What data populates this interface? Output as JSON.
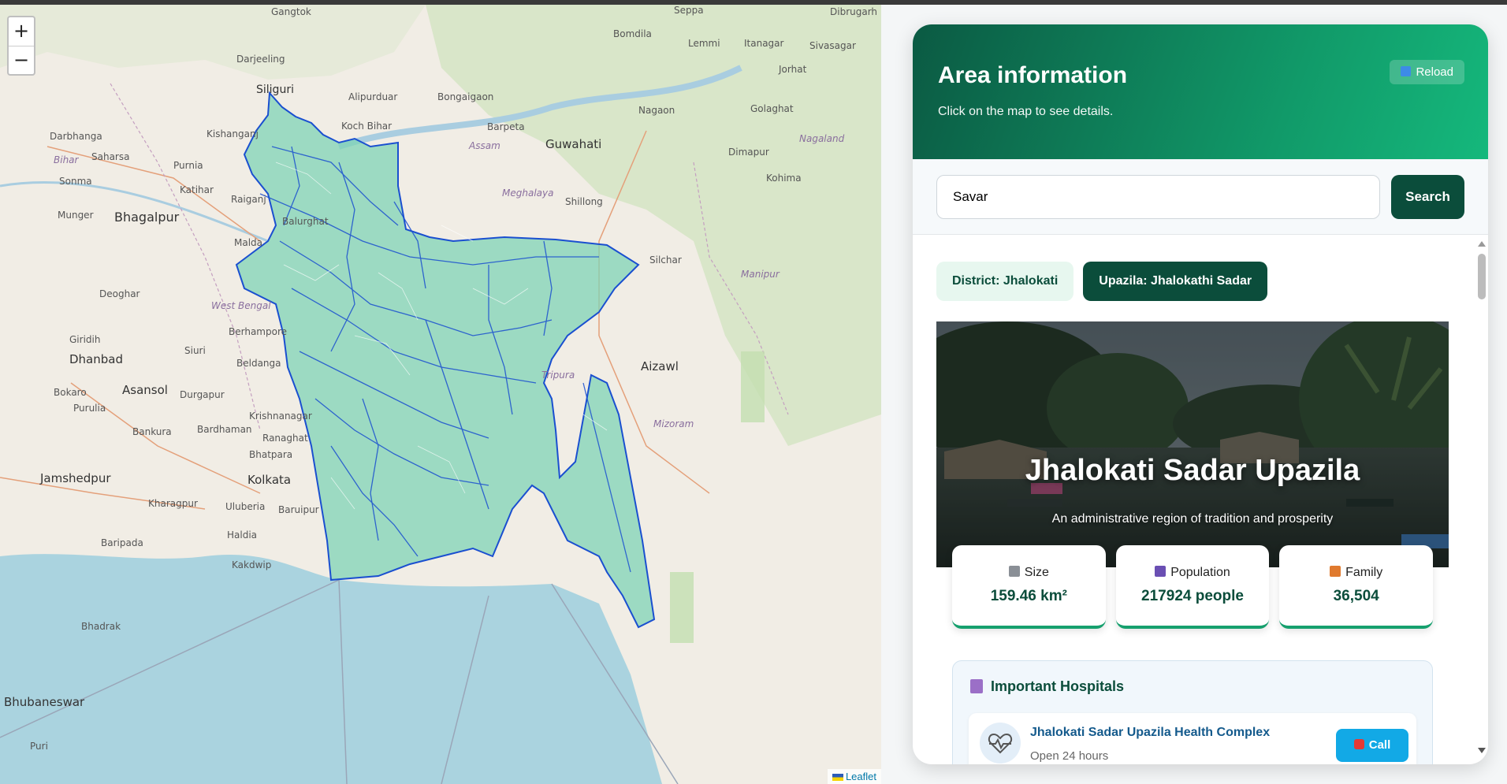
{
  "map": {
    "zoom_in": "+",
    "zoom_out": "−",
    "attribution": "Leaflet",
    "labels": [
      {
        "text": "Gangtok"
      },
      {
        "text": "Seppa"
      },
      {
        "text": "Dibrugarh"
      },
      {
        "text": "Bomdila"
      },
      {
        "text": "Lemmi"
      },
      {
        "text": "Itanagar"
      },
      {
        "text": "Sivasagar"
      },
      {
        "text": "Darjeeling"
      },
      {
        "text": "Jorhat"
      },
      {
        "text": "Siliguri"
      },
      {
        "text": "Alipurduar"
      },
      {
        "text": "Bongaigaon"
      },
      {
        "text": "Nagaon"
      },
      {
        "text": "Golaghat"
      },
      {
        "text": "Kishanganj"
      },
      {
        "text": "Koch Bihar"
      },
      {
        "text": "Barpeta"
      },
      {
        "text": "Darbhanga"
      },
      {
        "text": "Assam"
      },
      {
        "text": "Guwahati"
      },
      {
        "text": "Nagaland"
      },
      {
        "text": "Bihar"
      },
      {
        "text": "Saharsa"
      },
      {
        "text": "Purnia"
      },
      {
        "text": "Dimapur"
      },
      {
        "text": "Sonma"
      },
      {
        "text": "Kohima"
      },
      {
        "text": "Katihar"
      },
      {
        "text": "Meghalaya"
      },
      {
        "text": "Raiganj"
      },
      {
        "text": "Shillong"
      },
      {
        "text": "Munger"
      },
      {
        "text": "Bhagalpur"
      },
      {
        "text": "Balurghat"
      },
      {
        "text": "Malda"
      },
      {
        "text": "Silchar"
      },
      {
        "text": "Manipur"
      },
      {
        "text": "Deoghar"
      },
      {
        "text": "West Bengal"
      },
      {
        "text": "Berhampore"
      },
      {
        "text": "Giridih"
      },
      {
        "text": "Siuri"
      },
      {
        "text": "Dhanbad"
      },
      {
        "text": "Beldanga"
      },
      {
        "text": "Aizawl"
      },
      {
        "text": "Tripura"
      },
      {
        "text": "Bokaro"
      },
      {
        "text": "Asansol"
      },
      {
        "text": "Durgapur"
      },
      {
        "text": "Purulia"
      },
      {
        "text": "Krishnanagar"
      },
      {
        "text": "Mizoram"
      },
      {
        "text": "Bankura"
      },
      {
        "text": "Bardhaman"
      },
      {
        "text": "Ranaghat"
      },
      {
        "text": "Bhatpara"
      },
      {
        "text": "Jamshedpur"
      },
      {
        "text": "Kolkata"
      },
      {
        "text": "Kharagpur"
      },
      {
        "text": "Uluberia"
      },
      {
        "text": "Baruipur"
      },
      {
        "text": "Haldia"
      },
      {
        "text": "Baripada"
      },
      {
        "text": "Kakdwip"
      },
      {
        "text": "Bhadrak"
      },
      {
        "text": "Bhubaneswar"
      },
      {
        "text": "Puri"
      }
    ]
  },
  "panel": {
    "title": "Area information",
    "subtitle": "Click on the map to see details.",
    "reload_label": "Reload",
    "search": {
      "value": "Savar",
      "button": "Search"
    },
    "chips": {
      "district": "District: Jhalokati",
      "upazila": "Upazila: Jhalokathi Sadar"
    },
    "hero": {
      "title": "Jhalokati Sadar Upazila",
      "subtitle": "An administrative region of tradition and prosperity"
    },
    "stats": [
      {
        "label": "Size",
        "value": "159.46 km²",
        "icon": "ruler-icon",
        "icon_color": "#8a8f96"
      },
      {
        "label": "Population",
        "value": "217924 people",
        "icon": "people-icon",
        "icon_color": "#6a4fb3"
      },
      {
        "label": "Family",
        "value": "36,504",
        "icon": "house-icon",
        "icon_color": "#e07a2e"
      }
    ],
    "hospitals": {
      "title": "Important Hospitals",
      "items": [
        {
          "name": "Jhalokati Sadar Upazila Health Complex",
          "hours": "Open 24 hours",
          "call": "Call"
        }
      ]
    }
  },
  "colors": {
    "accent_dark": "#0b4d3b",
    "accent": "#119a69",
    "map_fill": "#7fd3b5",
    "map_border": "#1a4fd0",
    "call": "#12a9e6"
  }
}
